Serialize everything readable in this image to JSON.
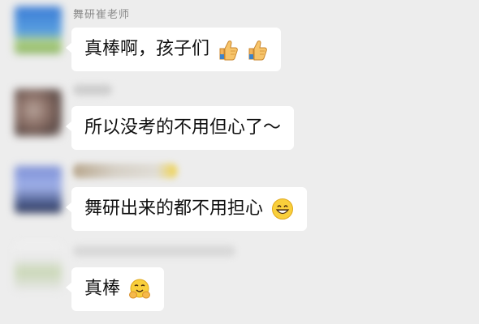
{
  "chat": {
    "messages": [
      {
        "sender": "舞研崔老师",
        "text": "真棒啊，孩子们",
        "emojis": [
          "thumbs-up-icon",
          "thumbs-up-icon"
        ]
      },
      {
        "sender": "",
        "text": "所以没考的不用但心了～",
        "emojis": []
      },
      {
        "sender": "",
        "text": "舞研出来的都不用担心",
        "emojis": [
          "grinning-face-icon"
        ]
      },
      {
        "sender": "",
        "text": "真棒",
        "emojis": [
          "hugging-face-icon"
        ]
      }
    ]
  }
}
